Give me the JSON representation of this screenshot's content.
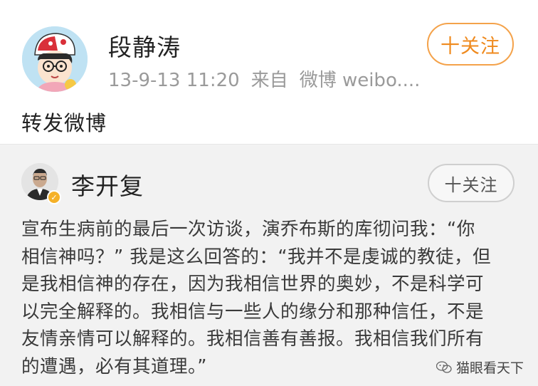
{
  "post": {
    "author": "段静涛",
    "timestamp": "13-9-13 11:20",
    "source_prefix": "来自",
    "source": "微博 weibo....",
    "follow_label": "十关注",
    "text": "转发微博"
  },
  "repost": {
    "author": "李开复",
    "follow_label": "十关注",
    "lines": [
      "宣布生病前的最后一次访谈，演乔布斯的库彻问我：“你",
      "相信神吗？” 我是这么回答的：“我并不是虔诚的教徒，但",
      "是我相信神的存在，因为我相信世界的奥妙，不是科学可",
      "以完全解释的。我相信与一些人的缘分和那种信任，不是",
      "友情亲情可以解释的。我相信善有善报。我相信我们所有",
      "的遭遇，必有其道理。”"
    ]
  },
  "watermark": {
    "text": "猫眼看天下",
    "icon": "wechat-bubble-icon"
  },
  "colors": {
    "follow_accent": "#ef8a1e",
    "repost_background": "#f2f2f2",
    "meta_gray": "#9a9a9a",
    "verified_badge": "#f5b128"
  }
}
